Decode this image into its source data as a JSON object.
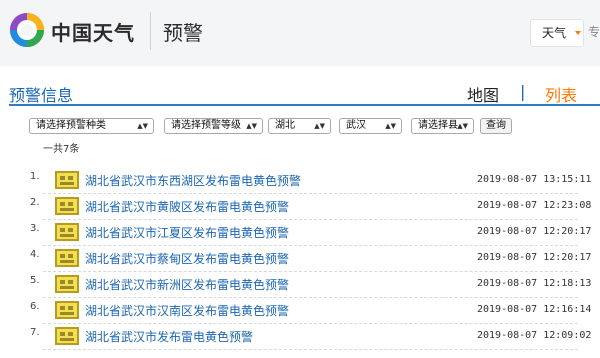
{
  "header": {
    "logo_text": "中国天气",
    "page_title": "预警",
    "weather_button": "天气",
    "side_text": "专"
  },
  "section": {
    "title": "预警信息",
    "views": [
      "地图",
      "|",
      "列表"
    ],
    "active_view": "列表"
  },
  "filters": {
    "type_select": "请选择预警种类",
    "level_select": "请选择预警等级",
    "province_select": "湖北",
    "city_select": "武汉",
    "county_select": "请选择县",
    "query_button": "查询"
  },
  "count_text": "一共7条",
  "alerts": [
    {
      "index": "1.",
      "title": "湖北省武汉市东西湖区发布雷电黄色预警",
      "time": "2019-08-07 13:15:11"
    },
    {
      "index": "2.",
      "title": "湖北省武汉市黄陂区发布雷电黄色预警",
      "time": "2019-08-07 12:23:08"
    },
    {
      "index": "3.",
      "title": "湖北省武汉市江夏区发布雷电黄色预警",
      "time": "2019-08-07 12:20:17"
    },
    {
      "index": "4.",
      "title": "湖北省武汉市蔡甸区发布雷电黄色预警",
      "time": "2019-08-07 12:20:17"
    },
    {
      "index": "5.",
      "title": "湖北省武汉市新洲区发布雷电黄色预警",
      "time": "2019-08-07 12:18:13"
    },
    {
      "index": "6.",
      "title": "湖北省武汉市汉南区发布雷电黄色预警",
      "time": "2019-08-07 12:16:14"
    },
    {
      "index": "7.",
      "title": "湖北省武汉市发布雷电黄色预警",
      "time": "2019-08-07 12:09:02"
    }
  ],
  "colors": {
    "link_blue": "#1b66b1",
    "active_orange": "#ff7a00",
    "warning_yellow": "#f2df52"
  },
  "icons": {
    "logo": "sunburst-logo-icon",
    "caret": "caret-down-icon",
    "alert": "thunder-yellow-warning-icon"
  }
}
